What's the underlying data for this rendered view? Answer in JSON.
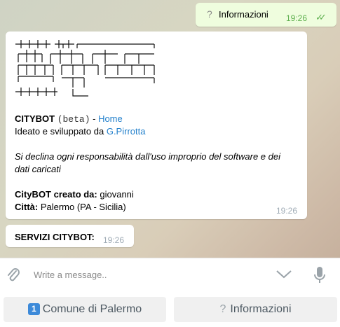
{
  "messages": {
    "outgoing": {
      "text": "Informazioni",
      "time": "19:26"
    },
    "bot_info": {
      "logo_name": "citybot-ascii-logo",
      "citybot": "CITYBOT",
      "beta": "(beta)",
      "dash": " - ",
      "home_link": "Home",
      "ideato_text": "Ideato e sviluppato da ",
      "author_link": "G.Pirrotta",
      "disclaimer_line1": "Si declina ogni responsabilità dall'uso improprio del software e dei",
      "disclaimer_line2": "dati caricati",
      "created_label": "CityBOT creato da:",
      "created_value": " giovanni",
      "city_label": "Città:",
      "city_value": " Palermo (PA - Sicilia)",
      "time": "19:26"
    },
    "services": {
      "text": "SERVIZI CITYBOT:",
      "time": "19:26"
    }
  },
  "composer": {
    "placeholder": "Write a message.."
  },
  "keyboard": {
    "left_number": "1",
    "left_label": "Comune di Palermo",
    "right_label": "Informazioni"
  },
  "colors": {
    "link": "#2481cc",
    "outgoing_bg": "#effdde",
    "read_check": "#5fb04f",
    "button_bg": "#f0f0f0",
    "number_badge": "#3d8ad9"
  }
}
